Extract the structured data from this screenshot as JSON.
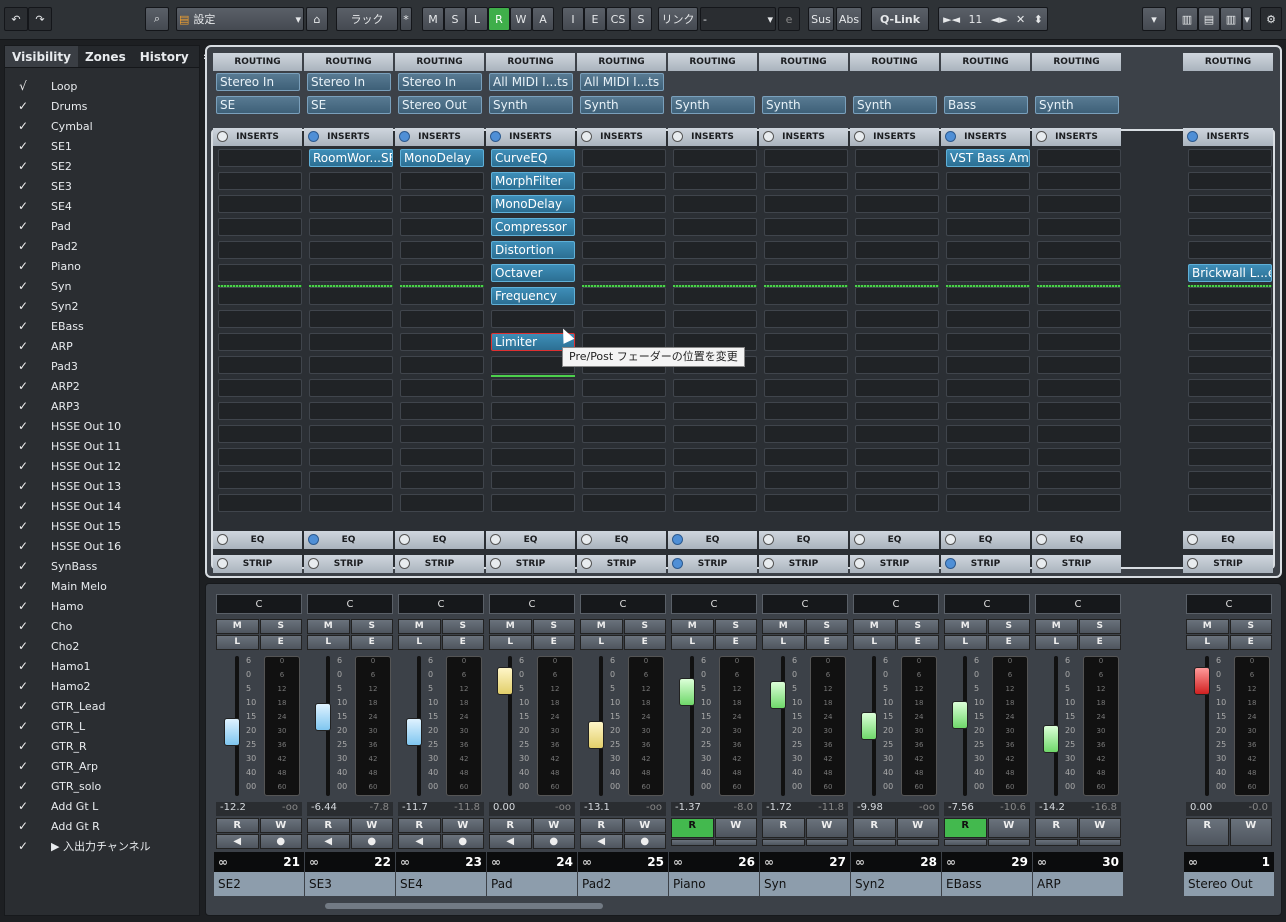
{
  "toolbar": {
    "undo": "↶",
    "redo": "↷",
    "search": "⌕",
    "config_label": "設定",
    "rack_label": "ラック",
    "rack_star": "*",
    "msl": [
      "M",
      "S",
      "L",
      "R",
      "W",
      "A"
    ],
    "iecs": [
      "I",
      "E",
      "CS",
      "S"
    ],
    "link_label": "リンク",
    "link_value": "-",
    "link_e": "e",
    "sus": "Sus",
    "abs": "Abs",
    "qlink": "Q-Link",
    "nav_prev": "►◄",
    "nav_num": "11",
    "nav_arrows": "◄►",
    "nav_x": "✕",
    "nav_updown": "⬍"
  },
  "left": {
    "tabs": [
      "Visibility",
      "Zones",
      "History"
    ],
    "menu": "=",
    "items": [
      {
        "check": "√",
        "name": "Loop"
      },
      {
        "check": "✓",
        "name": "Drums"
      },
      {
        "check": "✓",
        "name": "Cymbal"
      },
      {
        "check": "✓",
        "name": "SE1"
      },
      {
        "check": "✓",
        "name": "SE2"
      },
      {
        "check": "✓",
        "name": "SE3"
      },
      {
        "check": "✓",
        "name": "SE4"
      },
      {
        "check": "✓",
        "name": "Pad"
      },
      {
        "check": "✓",
        "name": "Pad2"
      },
      {
        "check": "✓",
        "name": "Piano"
      },
      {
        "check": "✓",
        "name": "Syn"
      },
      {
        "check": "✓",
        "name": "Syn2"
      },
      {
        "check": "✓",
        "name": "EBass"
      },
      {
        "check": "✓",
        "name": "ARP"
      },
      {
        "check": "✓",
        "name": "Pad3"
      },
      {
        "check": "✓",
        "name": "ARP2"
      },
      {
        "check": "✓",
        "name": "ARP3"
      },
      {
        "check": "✓",
        "name": "HSSE Out 10"
      },
      {
        "check": "✓",
        "name": "HSSE Out 11"
      },
      {
        "check": "✓",
        "name": "HSSE Out 12"
      },
      {
        "check": "✓",
        "name": "HSSE Out 13"
      },
      {
        "check": "✓",
        "name": "HSSE Out 14"
      },
      {
        "check": "✓",
        "name": "HSSE Out 15"
      },
      {
        "check": "✓",
        "name": "HSSE Out 16"
      },
      {
        "check": "✓",
        "name": "SynBass"
      },
      {
        "check": "✓",
        "name": "Main Melo"
      },
      {
        "check": "✓",
        "name": "Hamo"
      },
      {
        "check": "✓",
        "name": "Cho"
      },
      {
        "check": "✓",
        "name": "Cho2"
      },
      {
        "check": "✓",
        "name": "Hamo1"
      },
      {
        "check": "✓",
        "name": "Hamo2"
      },
      {
        "check": "✓",
        "name": "GTR_Lead"
      },
      {
        "check": "✓",
        "name": "GTR_L"
      },
      {
        "check": "✓",
        "name": "GTR_R"
      },
      {
        "check": "✓",
        "name": "GTR_Arp"
      },
      {
        "check": "✓",
        "name": "GTR_solo"
      },
      {
        "check": "✓",
        "name": "Add Gt L"
      },
      {
        "check": "✓",
        "name": "Add Gt R"
      },
      {
        "check": "✓",
        "name": "▶  入出力チャンネル"
      }
    ]
  },
  "rack": {
    "routing_label": "ROUTING",
    "inserts_label": "INSERTS",
    "eq_label": "EQ",
    "strip_label": "STRIP",
    "tooltip": "Pre/Post フェーダーの位置を変更"
  },
  "channels": [
    {
      "name": "SE2",
      "num": "21",
      "in": "Stereo In",
      "out": "SE",
      "ins_on": false,
      "eq_on": false,
      "strip_on": false,
      "inserts": [],
      "vol": "-12.2",
      "peak": "-oo",
      "fader": 0.55,
      "cap": "blue",
      "r_on": false,
      "rw_icons": true
    },
    {
      "name": "SE3",
      "num": "22",
      "in": "Stereo In",
      "out": "SE",
      "ins_on": true,
      "eq_on": true,
      "strip_on": false,
      "inserts": [
        "RoomWor...SE"
      ],
      "vol": "-6.44",
      "peak": "-7.8",
      "fader": 0.42,
      "cap": "blue",
      "r_on": false,
      "rw_icons": true
    },
    {
      "name": "SE4",
      "num": "23",
      "in": "Stereo In",
      "out": "Stereo Out",
      "ins_on": true,
      "eq_on": false,
      "strip_on": false,
      "inserts": [
        "MonoDelay"
      ],
      "vol": "-11.7",
      "peak": "-11.8",
      "fader": 0.55,
      "cap": "blue",
      "r_on": false,
      "rw_icons": true
    },
    {
      "name": "Pad",
      "num": "24",
      "in": "All MIDI I...ts",
      "out": "Synth",
      "ins_on": true,
      "eq_on": false,
      "strip_on": false,
      "inserts": [
        "CurveEQ",
        "MorphFilter",
        "MonoDelay",
        "Compressor",
        "Distortion",
        "Octaver",
        "Frequency",
        "",
        "Limiter"
      ],
      "vol": "0.00",
      "peak": "-oo",
      "fader": 0.1,
      "cap": "yellow",
      "r_on": false,
      "rw_icons": true
    },
    {
      "name": "Pad2",
      "num": "25",
      "in": "All MIDI I...ts",
      "out": "Synth",
      "ins_on": false,
      "eq_on": false,
      "strip_on": false,
      "inserts": [],
      "vol": "-13.1",
      "peak": "-oo",
      "fader": 0.58,
      "cap": "yellow",
      "r_on": false,
      "rw_icons": true
    },
    {
      "name": "Piano",
      "num": "26",
      "in": "",
      "out": "Synth",
      "ins_on": false,
      "eq_on": true,
      "strip_on": true,
      "inserts": [],
      "vol": "-1.37",
      "peak": "-8.0",
      "fader": 0.2,
      "cap": "green",
      "r_on": true,
      "rw_icons": false
    },
    {
      "name": "Syn",
      "num": "27",
      "in": "",
      "out": "Synth",
      "ins_on": false,
      "eq_on": false,
      "strip_on": false,
      "inserts": [],
      "vol": "-1.72",
      "peak": "-11.8",
      "fader": 0.22,
      "cap": "green",
      "r_on": false,
      "rw_icons": false
    },
    {
      "name": "Syn2",
      "num": "28",
      "in": "",
      "out": "Synth",
      "ins_on": false,
      "eq_on": false,
      "strip_on": false,
      "inserts": [],
      "vol": "-9.98",
      "peak": "-oo",
      "fader": 0.5,
      "cap": "green",
      "r_on": false,
      "rw_icons": false
    },
    {
      "name": "EBass",
      "num": "29",
      "in": "",
      "out": "Bass",
      "ins_on": true,
      "eq_on": false,
      "strip_on": true,
      "inserts": [
        "VST Bass Amp"
      ],
      "vol": "-7.56",
      "peak": "-10.6",
      "fader": 0.4,
      "cap": "green",
      "r_on": true,
      "rw_icons": false
    },
    {
      "name": "ARP",
      "num": "30",
      "in": "",
      "out": "Synth",
      "ins_on": false,
      "eq_on": false,
      "strip_on": false,
      "inserts": [],
      "vol": "-14.2",
      "peak": "-16.8",
      "fader": 0.62,
      "cap": "green",
      "r_on": false,
      "rw_icons": false
    }
  ],
  "master": {
    "name": "Stereo Out",
    "num": "1",
    "ins_on": true,
    "eq_on": false,
    "strip_on": false,
    "insert": "Brickwall L...er",
    "vol": "0.00",
    "peak": "-0.0",
    "fader": 0.1,
    "cap": "red"
  },
  "pan_label": "C",
  "scale": [
    "6",
    "0",
    "5",
    "10",
    "15",
    "20",
    "25",
    "30",
    "40",
    "00"
  ],
  "meter_scale": [
    "0",
    "6",
    "12",
    "18",
    "24",
    "30",
    "36",
    "42",
    "48",
    "60"
  ]
}
